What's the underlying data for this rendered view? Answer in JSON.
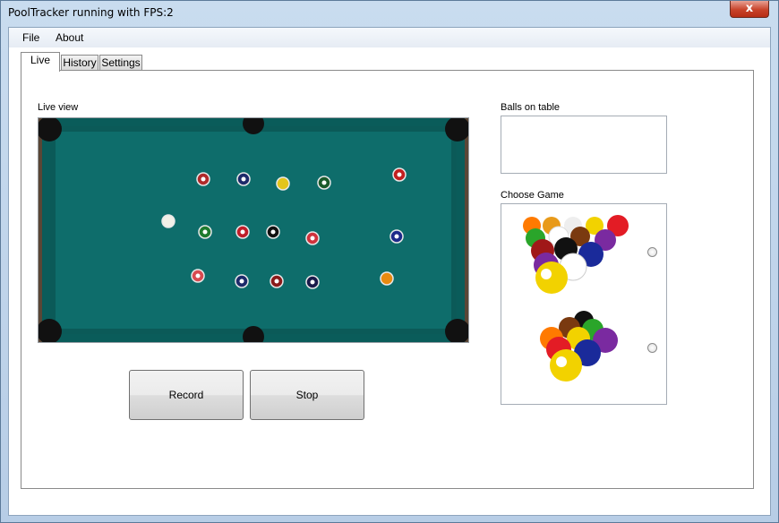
{
  "window": {
    "title": "PoolTracker running with FPS:2",
    "close_glyph": "x"
  },
  "menu": {
    "items": [
      "File",
      "About"
    ]
  },
  "tabs": [
    {
      "label": "Live",
      "active": true
    },
    {
      "label": "History",
      "active": false
    },
    {
      "label": "Settings",
      "active": false
    }
  ],
  "live": {
    "live_view_label": "Live view",
    "record_label": "Record",
    "stop_label": "Stop"
  },
  "side": {
    "balls_on_table_label": "Balls on table",
    "choose_game_label": "Choose Game",
    "games": [
      {
        "icon": "eight-ball-rack-icon",
        "selected": false
      },
      {
        "icon": "nine-ball-rack-icon",
        "selected": false
      }
    ]
  },
  "colors": {
    "felt": "#0e6d6b",
    "cushion": "#0a5a58",
    "frame_wood": "#6b4a33"
  }
}
